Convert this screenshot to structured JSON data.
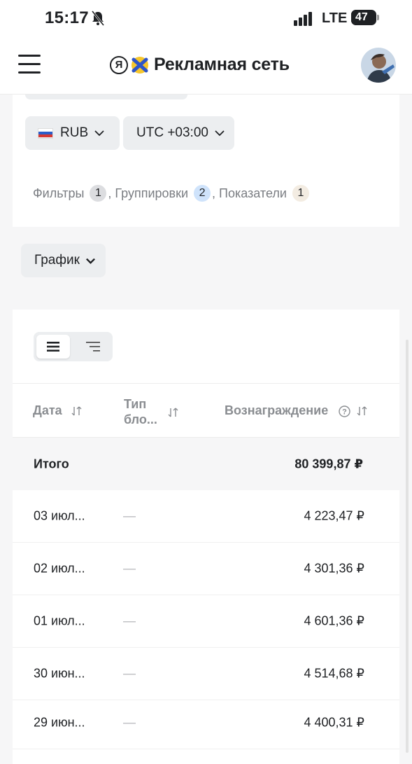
{
  "status_bar": {
    "time": "15:17",
    "network": "LTE",
    "battery": "47"
  },
  "header": {
    "brand_title": "Рекламная сеть",
    "logo_letter": "Я"
  },
  "selectors": {
    "currency": "RUB",
    "timezone": "UTC +03:00"
  },
  "filters": {
    "filters_label": "Фильтры",
    "filters_count": "1",
    "groupings_label": ", Группировки",
    "groupings_count": "2",
    "metrics_label": ", Показатели",
    "metrics_count": "1",
    "colors": {
      "filters_badge": "#dcdde0",
      "groupings_badge": "#cfe3fb",
      "metrics_badge": "#f3ece2"
    }
  },
  "chart_toggle": {
    "label": "График"
  },
  "view_toggle": {
    "active": "table-view-icon",
    "inactive": "tree-view-icon"
  },
  "table": {
    "columns": {
      "date": "Дата",
      "block_type_line1": "Тип",
      "block_type_line2": "бло...",
      "reward": "Вознаграждение"
    },
    "total": {
      "label": "Итого",
      "reward": "80 399,87 ₽"
    },
    "rows": [
      {
        "date": "03 июл...",
        "type": "—",
        "reward": "4 223,47 ₽"
      },
      {
        "date": "02 июл...",
        "type": "—",
        "reward": "4 301,36 ₽"
      },
      {
        "date": "01 июл...",
        "type": "—",
        "reward": "4 601,36 ₽"
      },
      {
        "date": "30 июн...",
        "type": "—",
        "reward": "4 514,68 ₽"
      },
      {
        "date": "29 июн...",
        "type": "—",
        "reward": "4 400,31 ₽"
      }
    ]
  }
}
